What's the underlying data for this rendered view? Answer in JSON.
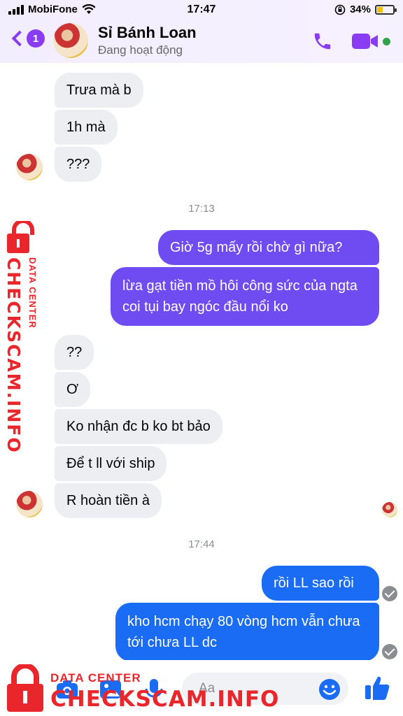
{
  "status_bar": {
    "carrier": "MobiFone",
    "time": "17:47",
    "battery_percent": "34%",
    "battery_level": 0.34
  },
  "header": {
    "back_badge": "1",
    "contact_name": "Sỉ Bánh Loan",
    "contact_status": "Đang hoạt động"
  },
  "messages": {
    "in_1": "Trưa mà b",
    "in_2": "1h mà",
    "in_3": "???",
    "timestamp_1": "17:13",
    "out_1": "Giờ 5g mấy rồi chờ gì nữa?",
    "out_2": "lừa gạt tiền mồ hôi công sức của ngta coi tụi bay ngóc đầu nổi ko",
    "in_4": "??",
    "in_5": "Ơ",
    "in_6": "Ko nhận đc b ko bt bảo",
    "in_7": "Để t ll với ship",
    "in_8": "R hoàn tiền à",
    "timestamp_2": "17:44",
    "out_3": "rồi LL sao rồi",
    "out_4": "kho hcm chạy 80 vòng hcm vẫn chưa tới chưa LL dc"
  },
  "composer": {
    "placeholder": "Aa"
  },
  "watermark": {
    "top_line": "DATA CENTER",
    "main_text": "CHECKSCAM.INFO"
  },
  "colors": {
    "accent_purple": "#8a3cf2",
    "bubble_purple": "#6f4bf2",
    "bubble_blue": "#1b6cf5",
    "incoming_bubble": "#eceef1",
    "watermark_red": "#e8262b"
  }
}
